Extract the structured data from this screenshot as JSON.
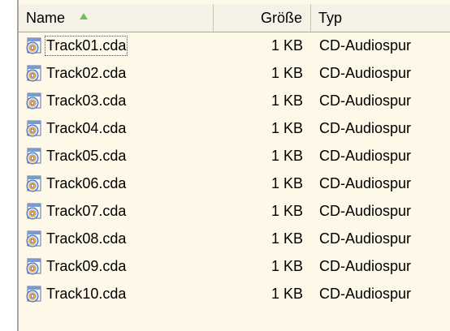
{
  "columns": {
    "name": "Name",
    "size": "Größe",
    "type": "Typ"
  },
  "files": [
    {
      "name": "Track01.cda",
      "size": "1 KB",
      "type": "CD-Audiospur"
    },
    {
      "name": "Track02.cda",
      "size": "1 KB",
      "type": "CD-Audiospur"
    },
    {
      "name": "Track03.cda",
      "size": "1 KB",
      "type": "CD-Audiospur"
    },
    {
      "name": "Track04.cda",
      "size": "1 KB",
      "type": "CD-Audiospur"
    },
    {
      "name": "Track05.cda",
      "size": "1 KB",
      "type": "CD-Audiospur"
    },
    {
      "name": "Track06.cda",
      "size": "1 KB",
      "type": "CD-Audiospur"
    },
    {
      "name": "Track07.cda",
      "size": "1 KB",
      "type": "CD-Audiospur"
    },
    {
      "name": "Track08.cda",
      "size": "1 KB",
      "type": "CD-Audiospur"
    },
    {
      "name": "Track09.cda",
      "size": "1 KB",
      "type": "CD-Audiospur"
    },
    {
      "name": "Track10.cda",
      "size": "1 KB",
      "type": "CD-Audiospur"
    }
  ],
  "icons": {
    "file": "cd-audio-track-icon",
    "sort": "sort-ascending-icon"
  },
  "colors": {
    "background": "#fdf8e7",
    "header": "#f1efe2",
    "sort_arrow": "#6ec05a"
  }
}
